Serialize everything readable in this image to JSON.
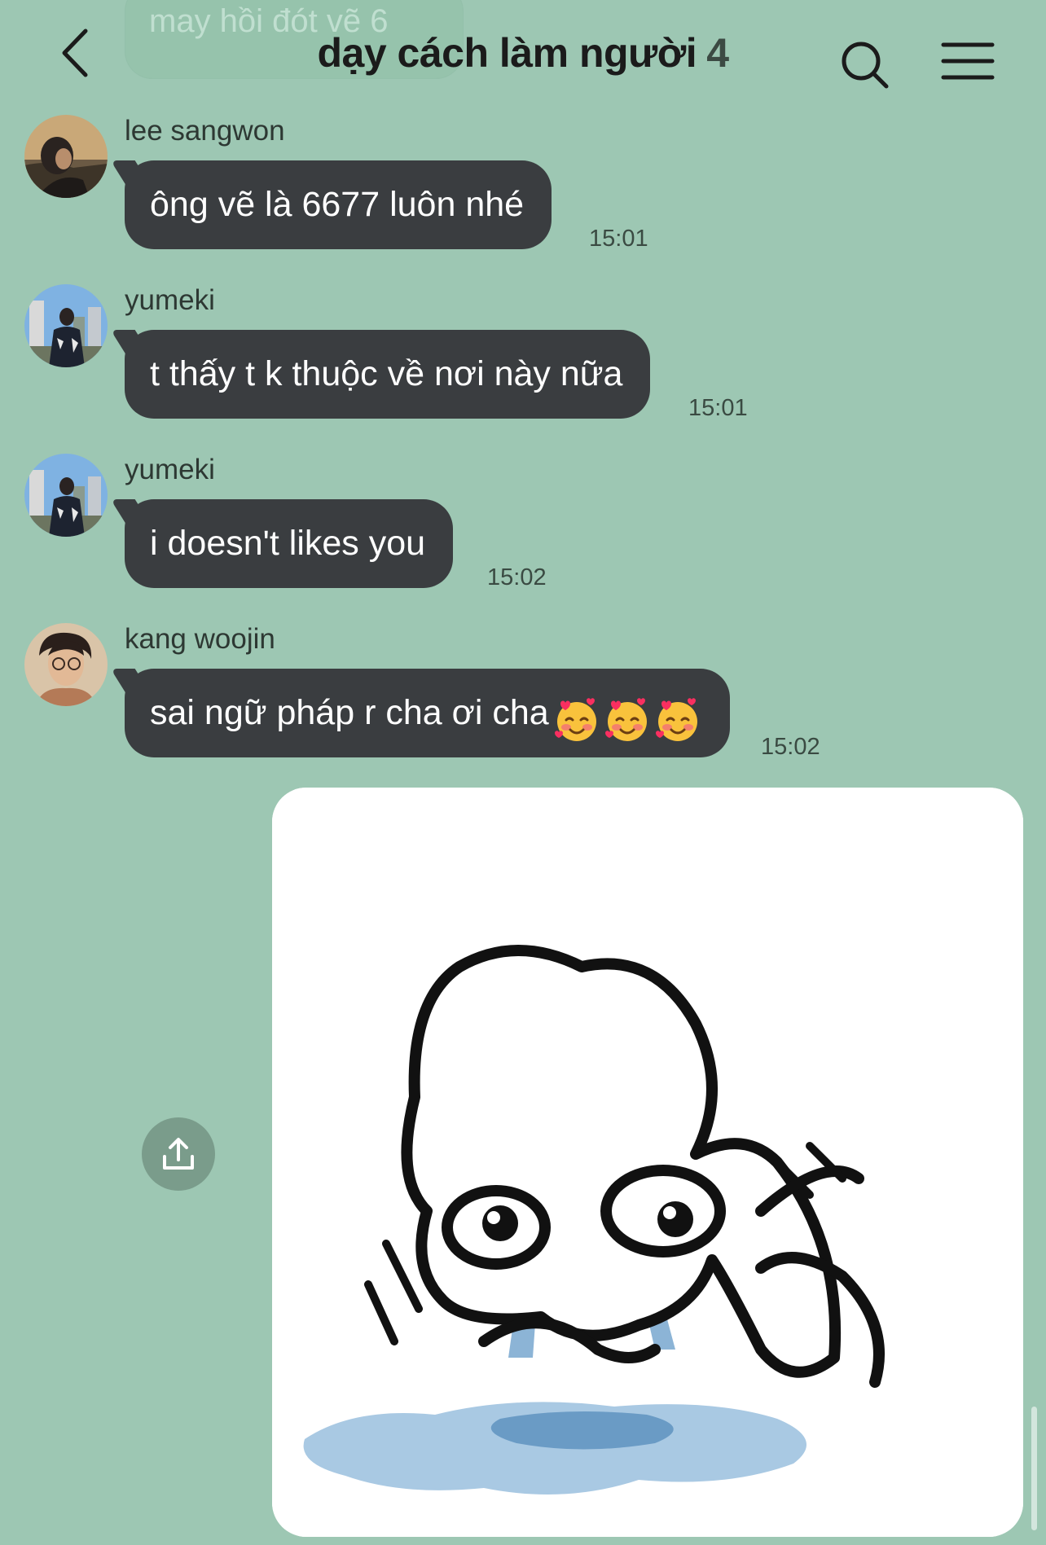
{
  "header": {
    "title": "dạy cách làm người",
    "member_count": "4",
    "icons": {
      "back": "chevron-left-icon",
      "search": "search-icon",
      "menu": "hamburger-menu-icon"
    }
  },
  "previous_message": {
    "text": "may hồi đót vẽ 6"
  },
  "messages": [
    {
      "sender": "lee sangwon",
      "text": "ông vẽ là 6677 luôn nhé",
      "time": "15:01"
    },
    {
      "sender": "yumeki",
      "text": "t thấy t k thuộc về nơi này nữa",
      "time": "15:01"
    },
    {
      "sender": "yumeki",
      "text": "i doesn't likes you",
      "time": "15:02"
    },
    {
      "sender": "kang woojin",
      "text": "sai ngữ pháp r cha ơi cha",
      "emoji": "smiling-face-with-hearts-icon",
      "time": "15:02"
    }
  ],
  "sticker": {
    "icon": "crying-meme-sticker"
  },
  "actions": {
    "share_icon": "share-upload-icon"
  },
  "colors": {
    "background": "#9dc7b3",
    "bubble": "#3a3d40",
    "bubble_text": "#ffffff",
    "share_button": "#7a9c8b"
  }
}
